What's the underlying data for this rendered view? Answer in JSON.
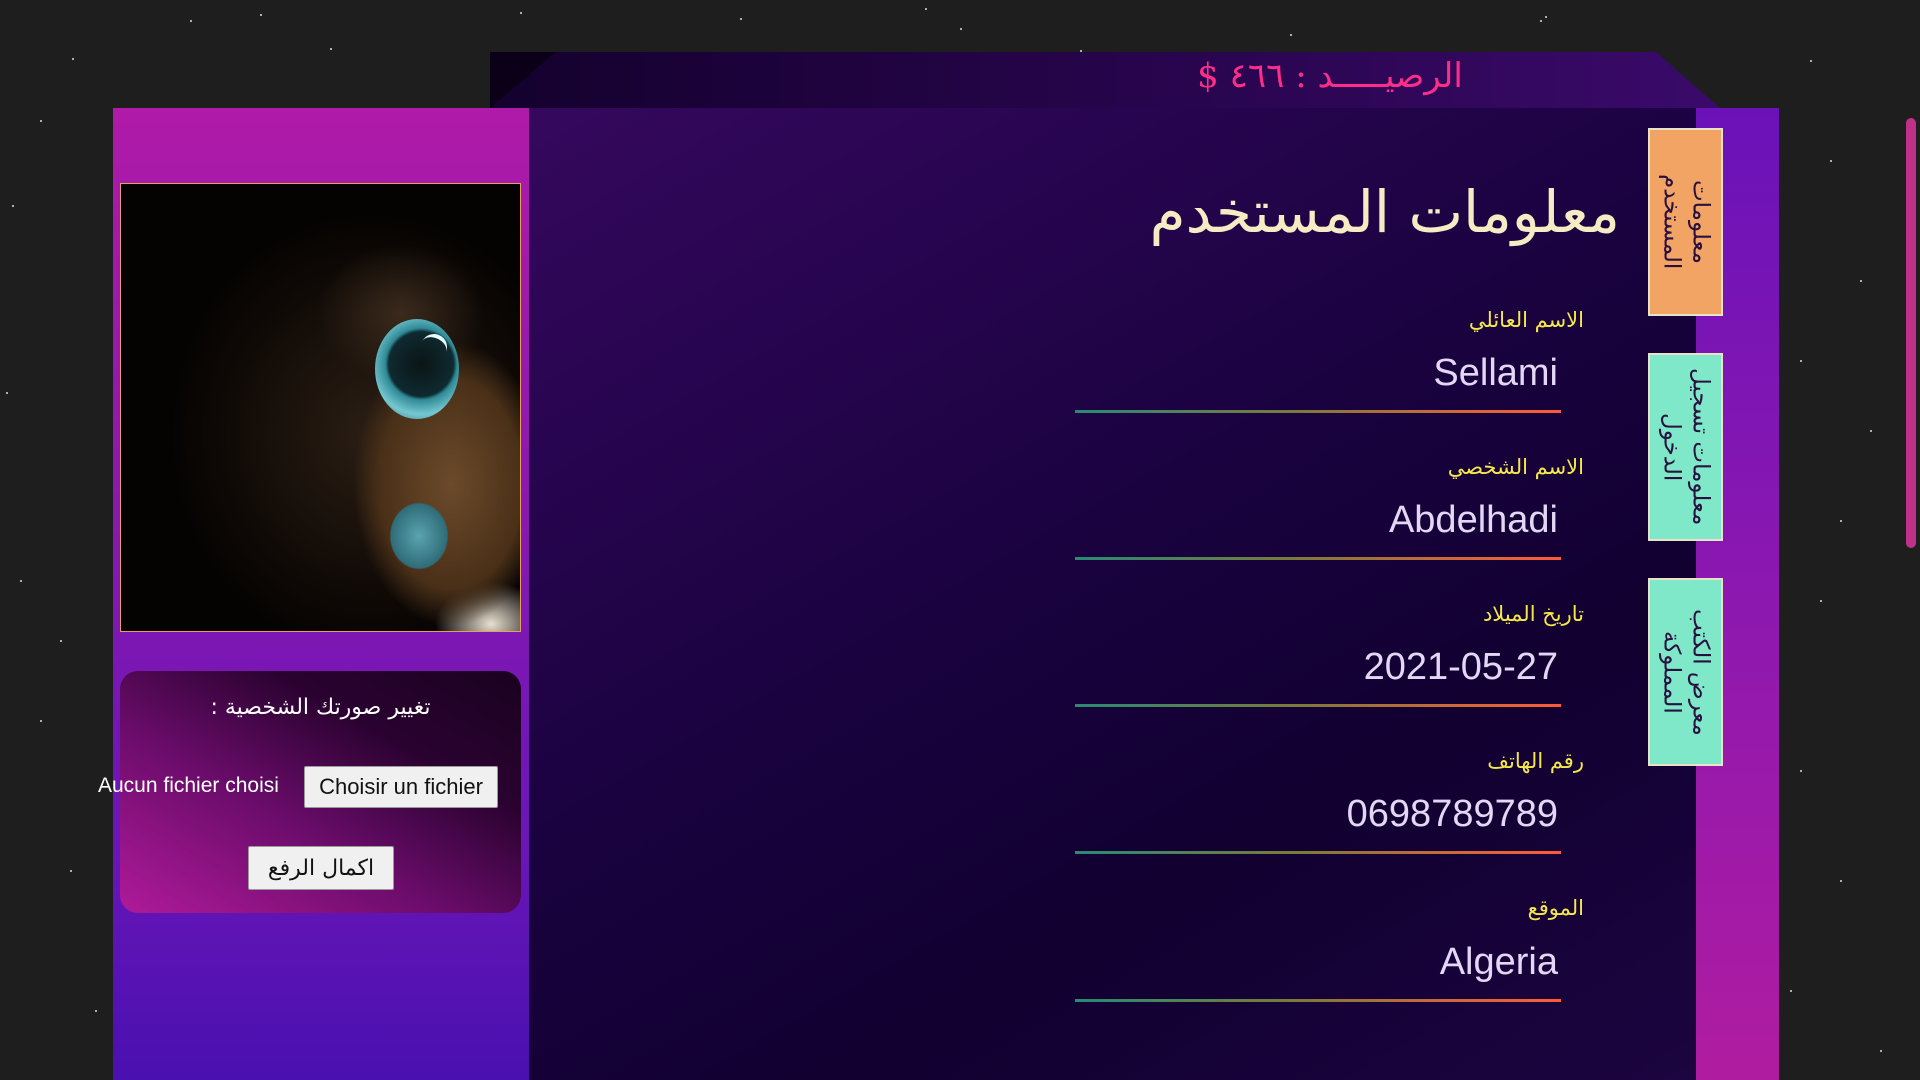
{
  "header": {
    "balance_text": "الرصيـــــد : ٤٦٦ $"
  },
  "profile": {
    "image_alt": "owl-photo",
    "upload": {
      "title": "تغيير صورتك الشخصية :",
      "no_file_text": "Aucun fichier choisi",
      "choose_file_label": "Choisir un fichier",
      "submit_label": "اكمال الرفع"
    }
  },
  "main": {
    "title": "معلومات المستخدم",
    "fields": [
      {
        "label": "الاسم العائلي",
        "value": "Sellami"
      },
      {
        "label": "الاسم الشخصي",
        "value": "Abdelhadi"
      },
      {
        "label": "تاريخ الميلاد",
        "value": "2021-05-27"
      },
      {
        "label": "رقم الهاتف",
        "value": "0698789789"
      },
      {
        "label": "الموقع",
        "value": "Algeria"
      }
    ]
  },
  "side_tabs": [
    {
      "label": "معلومات المستخدم",
      "active": true
    },
    {
      "label": "معلومات تسجيل الدخول",
      "active": false
    },
    {
      "label": "معرض الكتب المملوكة",
      "active": false
    }
  ],
  "colors": {
    "accent_pink": "#ff2d8a",
    "label_yellow": "#f5e94a",
    "title_cream": "#f6ecc4",
    "tab_active": "#f2a464",
    "tab_inactive": "#7ee8c8"
  }
}
